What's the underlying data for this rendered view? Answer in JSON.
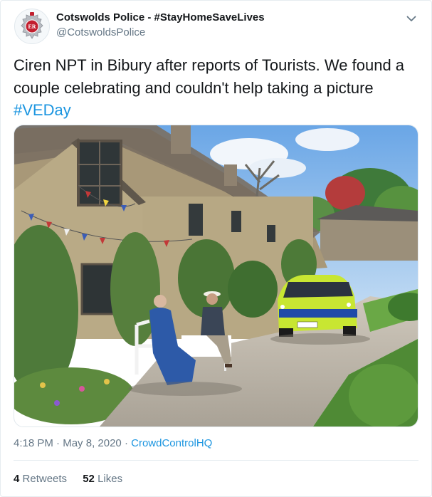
{
  "tweet": {
    "author_name": "Cotswolds Police - #StayHomeSaveLives",
    "author_handle": "@CotswoldsPolice",
    "text_line1": "Ciren NPT in Bibury after reports of Tourists. We found a",
    "text_line2": "couple celebrating and couldn't help taking a picture",
    "hashtag": "#VEDay",
    "time": "4:18 PM",
    "date": "May 8, 2020",
    "separator": "·",
    "source": "CrowdControlHQ",
    "retweets_count": "4",
    "retweets_label": "Retweets",
    "likes_count": "52",
    "likes_label": "Likes",
    "avatar_initials": "ER"
  },
  "colors": {
    "link": "#1b95e0",
    "muted": "#657786",
    "police_yellow": "#c8e632"
  },
  "icons": {
    "more": "chevron-down-icon",
    "avatar": "police-crest-icon"
  }
}
